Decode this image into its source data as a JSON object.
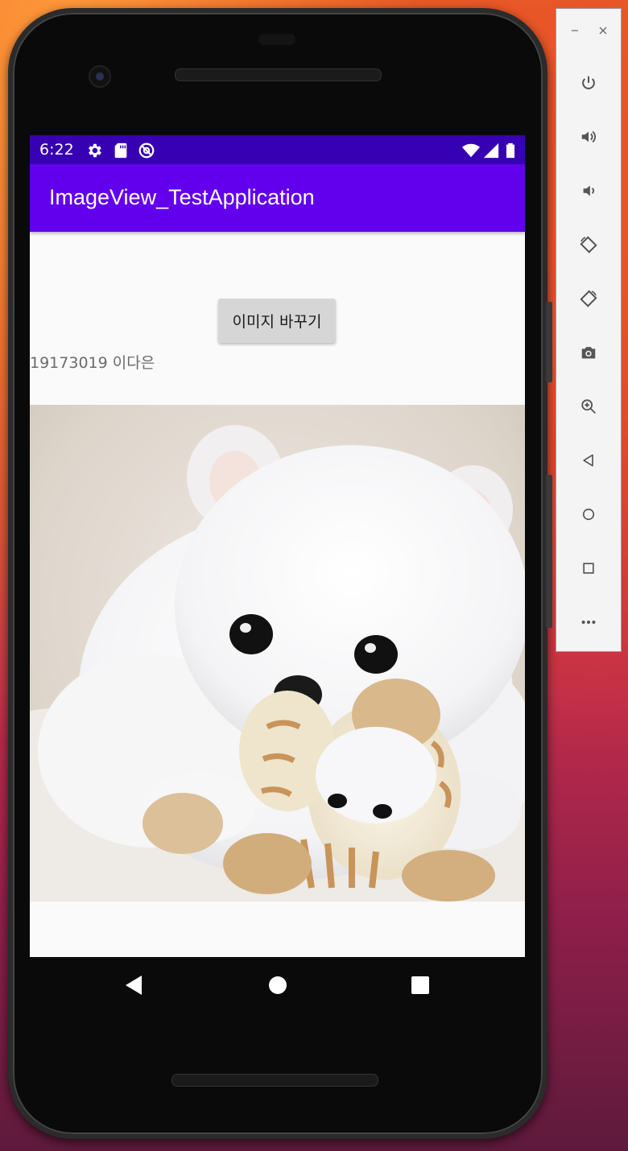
{
  "statusbar": {
    "time": "6:22",
    "icons": [
      "settings-icon",
      "sd-card-icon",
      "no-disturb-icon",
      "wifi-icon",
      "signal-icon",
      "battery-icon"
    ]
  },
  "appbar": {
    "title": "ImageView_TestApplication"
  },
  "main": {
    "button_label": "이미지 바꾸기",
    "student_text": "19173019 이다은",
    "image": "white-puppy-with-toy-image"
  },
  "navbar": {
    "buttons": [
      "back-icon",
      "home-icon",
      "recents-icon"
    ]
  },
  "emulator_panel": {
    "window_controls": [
      "minimize-icon",
      "close-icon"
    ],
    "tools": [
      "power-icon",
      "volume-up-icon",
      "volume-down-icon",
      "rotate-left-icon",
      "rotate-right-icon",
      "camera-icon",
      "zoom-icon",
      "back-icon",
      "home-icon",
      "overview-icon",
      "more-icon"
    ]
  },
  "colors": {
    "statusbar": "#3700b3",
    "appbar": "#6200ee",
    "screen_bg": "#fafafa",
    "button_bg": "#d6d6d6"
  }
}
